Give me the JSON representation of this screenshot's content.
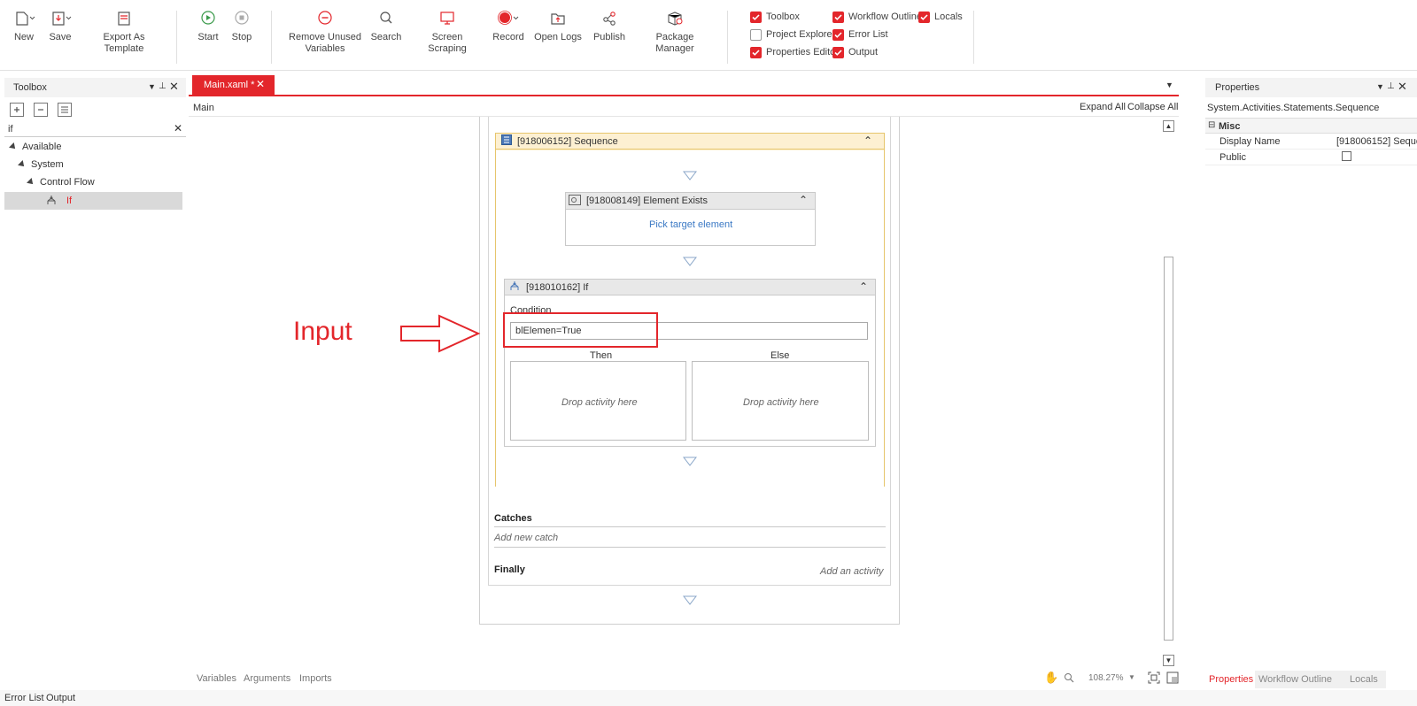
{
  "ribbon": {
    "new": "New",
    "save": "Save",
    "export_template": "Export As Template",
    "start": "Start",
    "stop": "Stop",
    "remove_unused_1": "Remove Unused",
    "remove_unused_2": "Variables",
    "search": "Search",
    "screen_scraping": "Screen Scraping",
    "record": "Record",
    "open_logs": "Open Logs",
    "publish": "Publish",
    "package_manager": "Package Manager",
    "panels": {
      "toolbox": "Toolbox",
      "project_explorer": "Project Explorer",
      "properties_editor": "Properties Editor",
      "workflow_outline": "Workflow Outline",
      "error_list": "Error List",
      "output": "Output",
      "locals": "Locals"
    }
  },
  "toolbox": {
    "title": "Toolbox",
    "search_value": "if",
    "tree": {
      "available": "Available",
      "system": "System",
      "control_flow": "Control Flow",
      "if_item": "If"
    }
  },
  "document_tab": {
    "label": "Main.xaml *"
  },
  "designer": {
    "breadcrumb": "Main",
    "expand_all": "Expand All",
    "collapse_all": "Collapse All",
    "sequence_title": "[918006152] Sequence",
    "element_exists_title": "[918008149] Element Exists",
    "pick_target": "Pick target element",
    "if_title": "[918010162] If",
    "condition_label": "Condition",
    "condition_value": "blElemen=True",
    "then_label": "Then",
    "else_label": "Else",
    "drop_then": "Drop activity here",
    "drop_else": "Drop activity here",
    "catches_label": "Catches",
    "add_new_catch": "Add new catch",
    "finally_label": "Finally",
    "add_activity": "Add an activity",
    "annotation_label": "Input"
  },
  "designer_footer": {
    "variables": "Variables",
    "arguments": "Arguments",
    "imports": "Imports",
    "zoom": "108.27%"
  },
  "properties": {
    "title": "Properties",
    "type_name": "System.Activities.Statements.Sequence",
    "category": "Misc",
    "display_name_label": "Display Name",
    "display_name_value": "[918006152] Seque",
    "public_label": "Public",
    "tabs": {
      "properties": "Properties",
      "workflow_outline": "Workflow Outline",
      "locals": "Locals"
    }
  },
  "bottom_bar": {
    "error_list": "Error List",
    "output": "Output"
  },
  "colors": {
    "accent": "#e3262b",
    "sequence_bg": "#fdf0d2",
    "sequence_border": "#e6c56c",
    "link": "#3b79c4"
  }
}
